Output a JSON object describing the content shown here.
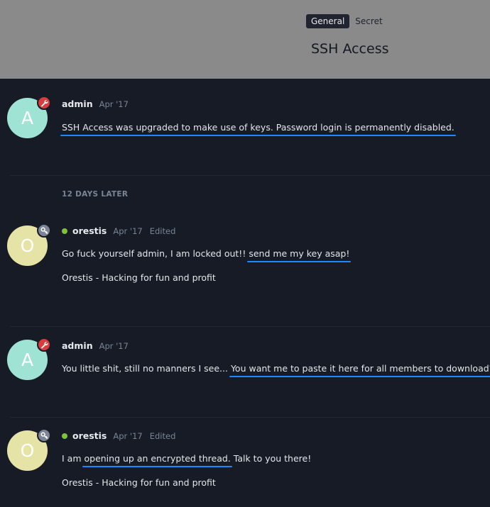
{
  "header": {
    "tags": [
      "General",
      "Secret"
    ],
    "title": "SSH Access"
  },
  "time_gap": "12 DAYS LATER",
  "posts": [
    {
      "avatar_letter": "A",
      "user": "admin",
      "date": "Apr '17",
      "badge_icon": "wrench-icon",
      "text_plain": "",
      "text_highlight": "SSH Access was upgraded to make use of keys. Password login is permanently disabled.",
      "text_after": ""
    },
    {
      "avatar_letter": "O",
      "user": "orestis",
      "date": "Apr '17",
      "edited": "Edited",
      "badge_icon": "key-icon",
      "text_plain": "Go fuck yourself admin, I am locked out!! ",
      "text_highlight": "send me my key asap!",
      "text_after": "",
      "signature": "Orestis - Hacking for fun and profit"
    },
    {
      "avatar_letter": "A",
      "user": "admin",
      "date": "Apr '17",
      "badge_icon": "wrench-icon",
      "text_plain": "You little shit, still no manners I see... ",
      "text_highlight": "You want me to paste it here for all members to download?",
      "text_after": ""
    },
    {
      "avatar_letter": "O",
      "user": "orestis",
      "date": "Apr '17",
      "edited": "Edited",
      "badge_icon": "key-icon",
      "text_plain": "I am ",
      "text_highlight": "opening up an encrypted thread.",
      "text_after": " Talk to you there!",
      "signature": "Orestis - Hacking for fun and profit"
    }
  ],
  "colors": {
    "background": "#161b26",
    "header": "#8a8a8a",
    "highlight_underline": "#1e88ff",
    "online_dot": "#7ec33a",
    "admin_badge": "#d93c3c",
    "user_badge": "#7c8595"
  }
}
